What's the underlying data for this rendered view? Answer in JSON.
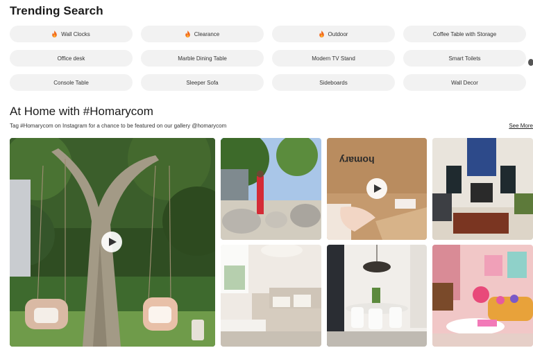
{
  "trending": {
    "title": "Trending Search",
    "chips": [
      {
        "label": "Wall Clocks",
        "hot": true
      },
      {
        "label": "Clearance",
        "hot": true
      },
      {
        "label": "Outdoor",
        "hot": true
      },
      {
        "label": "Coffee Table with Storage",
        "hot": false
      },
      {
        "label": "Office desk",
        "hot": false
      },
      {
        "label": "Marble Dining Table",
        "hot": false
      },
      {
        "label": "Modern TV Stand",
        "hot": false
      },
      {
        "label": "Smart Toilets",
        "hot": false
      },
      {
        "label": "Console Table",
        "hot": false
      },
      {
        "label": "Sleeper Sofa",
        "hot": false
      },
      {
        "label": "Sideboards",
        "hot": false
      },
      {
        "label": "Wall Decor",
        "hot": false
      }
    ]
  },
  "home": {
    "title": "At Home with #Homarycom",
    "subtitle": "Tag #Homarycom on Instagram for a chance to be featured on our gallery @homarycom",
    "see_more": "See More",
    "box_brand": "homary"
  },
  "colors": {
    "chip_bg": "#f2f2f2",
    "fire": "#f26b1d",
    "text": "#1a1a1a"
  }
}
